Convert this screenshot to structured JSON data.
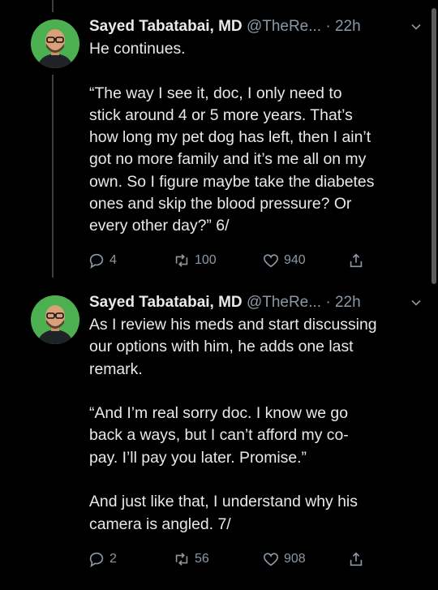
{
  "tweets": [
    {
      "name": "Sayed Tabatabai, MD",
      "handle": "@TheRe...",
      "time": "· 22h",
      "lines": [
        "He continues.",
        "",
        "“The way I see it, doc, I only need to",
        "stick around 4 or 5 more years.  That’s",
        "how long my pet dog has left, then I ain’t",
        "got no more family and it’s me all on my",
        "own.  So I figure maybe take the diabetes",
        "ones and skip the blood pressure?  Or",
        "every other day?”  6/"
      ],
      "replies": "4",
      "retweets": "100",
      "likes": "940"
    },
    {
      "name": "Sayed Tabatabai, MD",
      "handle": "@TheRe...",
      "time": "· 22h",
      "lines": [
        "As I review his meds and start discussing",
        "our options with him, he adds one last",
        "remark.",
        "",
        "“And I’m real sorry doc.  I know we go",
        "back a ways, but I can’t afford my co-",
        "pay.  I’ll pay you later.  Promise.”",
        "",
        "And just like that, I understand why his",
        "camera is angled.  7/"
      ],
      "replies": "2",
      "retweets": "56",
      "likes": "908"
    }
  ],
  "colors": {
    "background": "#000000",
    "text": "#e7e9ea",
    "muted": "#8b98a5",
    "avatar_bg": "#4caf50"
  },
  "icons": [
    "reply-icon",
    "retweet-icon",
    "like-icon",
    "share-icon",
    "chevron-down-icon"
  ]
}
